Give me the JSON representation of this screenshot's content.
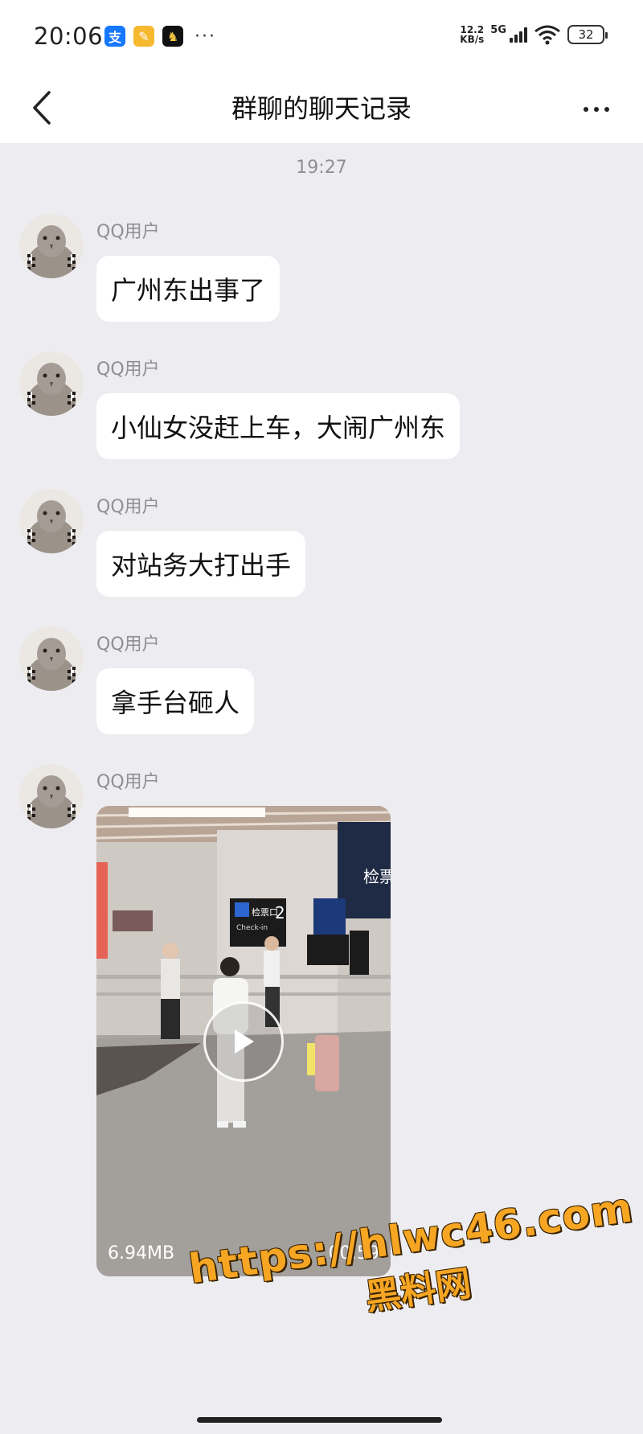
{
  "status_bar": {
    "time": "20:06",
    "app_icons": [
      "alipay-icon",
      "notes-icon",
      "app-icon"
    ],
    "more": "···",
    "net_speed_value": "12.2",
    "net_speed_unit": "KB/s",
    "net_type": "5G",
    "battery": "32"
  },
  "nav": {
    "title": "群聊的聊天记录"
  },
  "chat": {
    "timestamp": "19:27",
    "messages": [
      {
        "sender": "QQ用户",
        "text": "广州东出事了"
      },
      {
        "sender": "QQ用户",
        "text": "小仙女没赶上车，大闹广州东"
      },
      {
        "sender": "QQ用户",
        "text": "对站务大打出手"
      },
      {
        "sender": "QQ用户",
        "text": "拿手台砸人"
      },
      {
        "sender": "QQ用户",
        "video": {
          "size": "6.94MB",
          "duration": "00:59",
          "sign_text": "检票口2",
          "sign_text_en": "Check-in"
        }
      }
    ]
  },
  "watermark": {
    "url": "https://hlwc46.com",
    "name": "黑料网"
  }
}
